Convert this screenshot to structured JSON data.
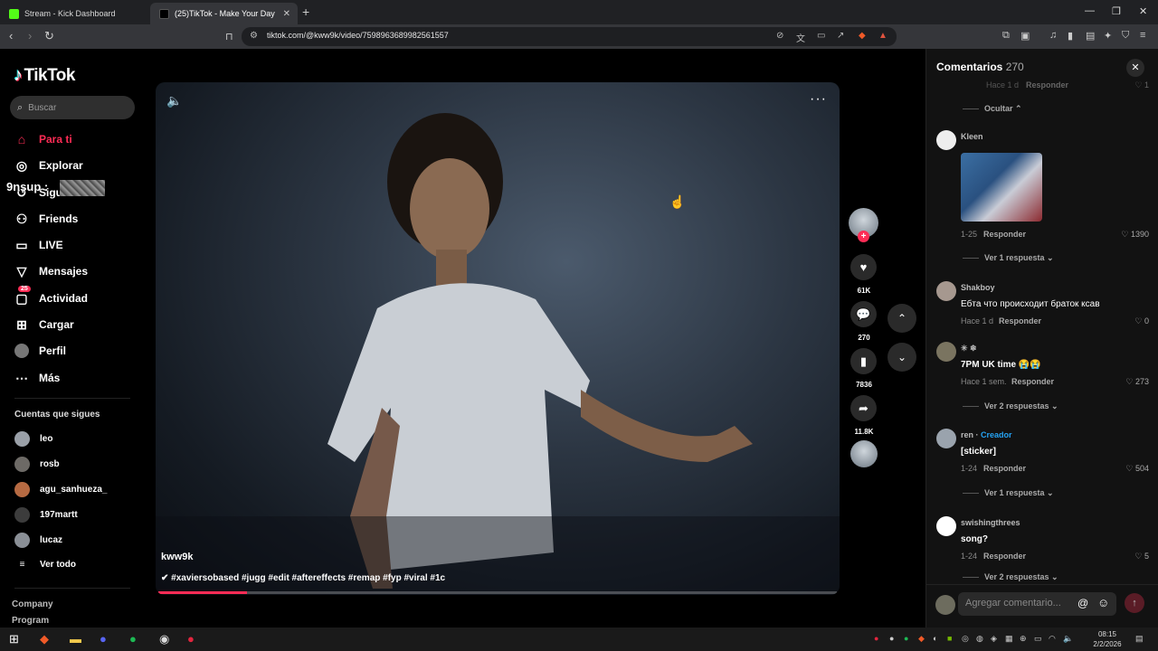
{
  "browser": {
    "tabs": [
      {
        "title": "Stream - Kick Dashboard",
        "color": "#53fc18"
      },
      {
        "title": "(25)TikTok - Make Your Day",
        "color": "#ffffff"
      }
    ],
    "url": "tiktok.com/@kww9k/video/7598963689982561557"
  },
  "sidebar": {
    "logo": "TikTok",
    "search_placeholder": "Buscar",
    "items": [
      {
        "label": "Para ti",
        "icon": "home-icon"
      },
      {
        "label": "Explorar",
        "icon": "compass-icon"
      },
      {
        "label": "Sigu",
        "icon": "following-icon"
      },
      {
        "label": "Friends",
        "icon": "friends-icon"
      },
      {
        "label": "LIVE",
        "icon": "live-icon"
      },
      {
        "label": "Mensajes",
        "icon": "messages-icon"
      },
      {
        "label": "Actividad",
        "icon": "activity-icon",
        "badge": "25"
      },
      {
        "label": "Cargar",
        "icon": "upload-icon"
      },
      {
        "label": "Perfil",
        "icon": "profile-icon"
      },
      {
        "label": "Más",
        "icon": "more-icon"
      }
    ],
    "overlay_name": "9nsup :",
    "following_title": "Cuentas que sigues",
    "following": [
      "leo",
      "rosb",
      "agu_sanhueza_",
      "197martt",
      "lucaz"
    ],
    "see_all": "Ver todo",
    "footer": [
      "Company",
      "Program"
    ]
  },
  "video": {
    "author": "kww9k",
    "caption": "✔ #xaviersobased #jugg #edit #aftereffects #remap #fyp #viral #1c",
    "progress": 0.13
  },
  "actions": {
    "likes": "61K",
    "comments": "270",
    "saves": "7836",
    "shares": "11.8K"
  },
  "comments_panel": {
    "title": "Comentarios",
    "count": "270",
    "top_meta": "Hace 1 d",
    "top_reply": "Responder",
    "top_like": "1",
    "hide": "Ocultar ⌃",
    "items": [
      {
        "user": "Kleen",
        "text": "",
        "date": "1-25",
        "reply": "Responder",
        "likes": "1390",
        "more": "Ver 1 respuesta ⌄"
      },
      {
        "user": "Shakboy",
        "text": "Ебта что происходит браток ксав",
        "date": "Hace 1 d",
        "reply": "Responder",
        "likes": "0",
        "more": ""
      },
      {
        "user": "✳ ❄",
        "text": "7PM UK time 😭😭",
        "date": "Hace 1 sem.",
        "reply": "Responder",
        "likes": "273",
        "more": "Ver 2 respuestas ⌄"
      },
      {
        "user": "ren ·",
        "creator": "Creador",
        "text": "[sticker]",
        "date": "1-24",
        "reply": "Responder",
        "likes": "504",
        "more": "Ver 1 respuesta ⌄"
      },
      {
        "user": "swishingthrees",
        "text": "song?",
        "date": "1-24",
        "reply": "Responder",
        "likes": "5",
        "more": "Ver 2 respuestas ⌄"
      }
    ],
    "input_placeholder": "Agregar comentario...",
    "accent": "#fe2c55"
  },
  "taskbar": {
    "time": "08:15",
    "date": "2/2/2026"
  }
}
